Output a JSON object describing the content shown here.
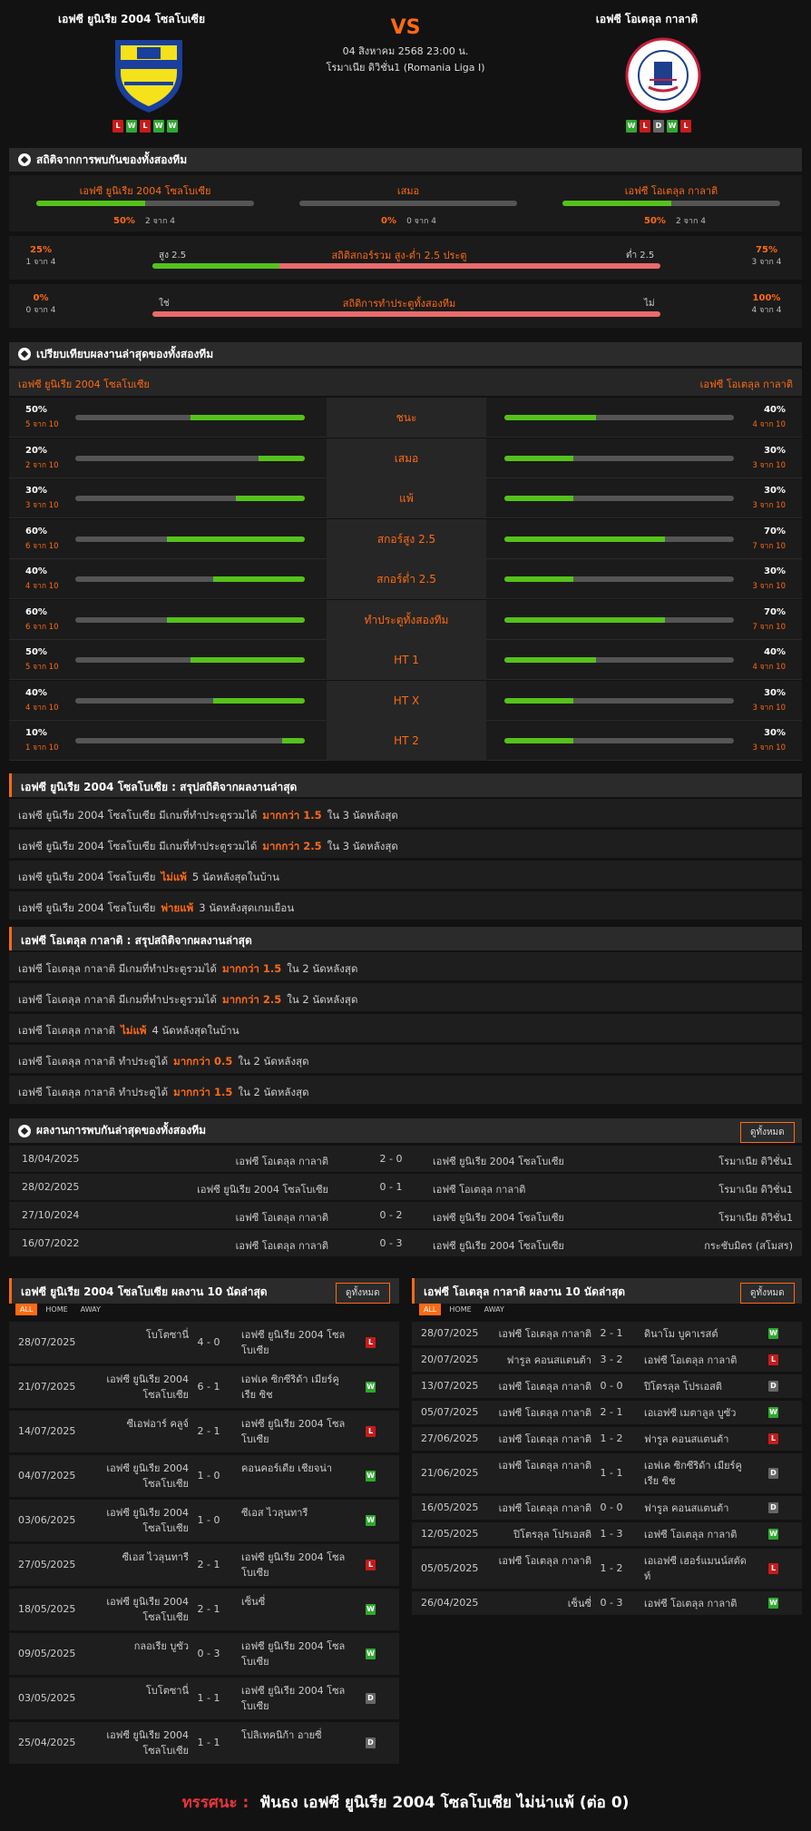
{
  "header": {
    "home": "เอฟซี ยูนิเรีย 2004 โซลโบเซีย",
    "away": "เอฟซี โอเตลุล กาลาติ",
    "vs": "VS",
    "date": "04 สิงหาคม 2568 23:00 น.",
    "league": "โรมาเนีย ดิวิชั่น1 (Romania Liga I)",
    "home_form": [
      "L",
      "W",
      "L",
      "W",
      "W"
    ],
    "away_form": [
      "W",
      "L",
      "D",
      "W",
      "L"
    ]
  },
  "h2h_stats": {
    "title": "สถิติจากการพบกันของทั้งสองทีม",
    "home": {
      "label": "เอฟซี ยูนิเรีย 2004 โซลโบเซีย",
      "pct": "50%",
      "sub": "2 จาก 4",
      "frac": 0.5
    },
    "draw": {
      "label": "เสมอ",
      "pct": "0%",
      "sub": "0 จาก 4",
      "frac": 0
    },
    "away": {
      "label": "เอฟซี โอเตลุล กาลาติ",
      "pct": "50%",
      "sub": "2 จาก 4",
      "frac": 0.5
    },
    "ou": {
      "title": "สถิติสกอร์รวม สูง-ต่ำ 2.5 ประตู",
      "left_pct": "25%",
      "left_sub": "1 จาก 4",
      "left_label": "สูง 2.5",
      "right_label": "ต่ำ 2.5",
      "right_pct": "75%",
      "right_sub": "3 จาก 4",
      "frac": 0.25
    },
    "btts": {
      "title": "สถิติการทำประตูทั้งสองทีม",
      "left_pct": "0%",
      "left_sub": "0 จาก 4",
      "left_label": "ใช่",
      "right_label": "ไม่",
      "right_pct": "100%",
      "right_sub": "4 จาก 4",
      "frac": 0
    }
  },
  "compare": {
    "title": "เปรียบเทียบผลงานล่าสุดของทั้งสองทีม",
    "home": "เอฟซี ยูนิเรีย 2004 โซลโบเซีย",
    "away": "เอฟซี โอเตลุล กาลาติ",
    "rows": [
      {
        "label": "ชนะ",
        "hp": "50%",
        "hs": "5 จาก 10",
        "hf": 0.5,
        "ap": "40%",
        "as": "4 จาก 10",
        "af": 0.4
      },
      {
        "label": "เสมอ",
        "hp": "20%",
        "hs": "2 จาก 10",
        "hf": 0.2,
        "ap": "30%",
        "as": "3 จาก 10",
        "af": 0.3
      },
      {
        "label": "แพ้",
        "hp": "30%",
        "hs": "3 จาก 10",
        "hf": 0.3,
        "ap": "30%",
        "as": "3 จาก 10",
        "af": 0.3
      },
      {
        "label": "สกอร์สูง 2.5",
        "hp": "60%",
        "hs": "6 จาก 10",
        "hf": 0.6,
        "ap": "70%",
        "as": "7 จาก 10",
        "af": 0.7
      },
      {
        "label": "สกอร์ต่ำ 2.5",
        "hp": "40%",
        "hs": "4 จาก 10",
        "hf": 0.4,
        "ap": "30%",
        "as": "3 จาก 10",
        "af": 0.3
      },
      {
        "label": "ทำประตูทั้งสองทีม",
        "hp": "60%",
        "hs": "6 จาก 10",
        "hf": 0.6,
        "ap": "70%",
        "as": "7 จาก 10",
        "af": 0.7
      },
      {
        "label": "HT 1",
        "hp": "50%",
        "hs": "5 จาก 10",
        "hf": 0.5,
        "ap": "40%",
        "as": "4 จาก 10",
        "af": 0.4
      },
      {
        "label": "HT X",
        "hp": "40%",
        "hs": "4 จาก 10",
        "hf": 0.4,
        "ap": "30%",
        "as": "3 จาก 10",
        "af": 0.3
      },
      {
        "label": "HT 2",
        "hp": "10%",
        "hs": "1 จาก 10",
        "hf": 0.1,
        "ap": "30%",
        "as": "3 จาก 10",
        "af": 0.3
      }
    ]
  },
  "home_summary": {
    "title": "เอฟซี ยูนิเรีย 2004 โซลโบเซีย : สรุปสถิติจากผลงานล่าสุด",
    "rows": [
      [
        "เอฟซี ยูนิเรีย 2004 โซลโบเซีย  มีเกมที่ทำประตูรวมได้",
        "มากกว่า  1.5",
        "ใน 3 นัดหลังสุด"
      ],
      [
        "เอฟซี ยูนิเรีย 2004 โซลโบเซีย  มีเกมที่ทำประตูรวมได้",
        "มากกว่า  2.5",
        "ใน 3 นัดหลังสุด"
      ],
      [
        "เอฟซี ยูนิเรีย 2004 โซลโบเซีย",
        "ไม่แพ้",
        "5  นัดหลังสุดในบ้าน"
      ],
      [
        "เอฟซี ยูนิเรีย 2004 โซลโบเซีย",
        "พ่ายแพ้",
        "3  นัดหลังสุดเกมเยือน"
      ]
    ]
  },
  "away_summary": {
    "title": "เอฟซี โอเตลุล กาลาติ : สรุปสถิติจากผลงานล่าสุด",
    "rows": [
      [
        "เอฟซี โอเตลุล กาลาติ  มีเกมที่ทำประตูรวมได้",
        "มากกว่า  1.5",
        "ใน 2 นัดหลังสุด"
      ],
      [
        "เอฟซี โอเตลุล กาลาติ  มีเกมที่ทำประตูรวมได้",
        "มากกว่า  2.5",
        "ใน 2 นัดหลังสุด"
      ],
      [
        "เอฟซี โอเตลุล กาลาติ",
        "ไม่แพ้",
        "4  นัดหลังสุดในบ้าน"
      ],
      [
        "เอฟซี โอเตลุล กาลาติ  ทำประตูได้",
        "มากกว่า  0.5",
        "ใน 2 นัดหลังสุด"
      ],
      [
        "เอฟซี โอเตลุล กาลาติ  ทำประตูได้",
        "มากกว่า  1.5",
        "ใน 2 นัดหลังสุด"
      ]
    ]
  },
  "h2h": {
    "title": "ผลงานการพบกันล่าสุดของทั้งสองทีม",
    "view_all": "ดูทั้งหมด",
    "rows": [
      [
        "18/04/2025",
        "เอฟซี โอเตลุล กาลาติ",
        "2 - 0",
        "เอฟซี ยูนิเรีย 2004 โซลโบเซีย",
        "โรมาเนีย ดิวิชั่น1"
      ],
      [
        "28/02/2025",
        "เอฟซี ยูนิเรีย 2004 โซลโบเซีย",
        "0 - 1",
        "เอฟซี โอเตลุล กาลาติ",
        "โรมาเนีย ดิวิชั่น1"
      ],
      [
        "27/10/2024",
        "เอฟซี โอเตลุล กาลาติ",
        "0 - 2",
        "เอฟซี ยูนิเรีย 2004 โซลโบเซีย",
        "โรมาเนีย ดิวิชั่น1"
      ],
      [
        "16/07/2022",
        "เอฟซี โอเตลุล กาลาติ",
        "0 - 3",
        "เอฟซี ยูนิเรีย 2004 โซลโบเซีย",
        "กระชับมิตร (สโมสร)"
      ]
    ]
  },
  "home_last": {
    "title": "เอฟซี ยูนิเรีย 2004 โซลโบเซีย ผลงาน 10 นัดล่าสุด",
    "view_all": "ดูทั้งหมด",
    "tabs": [
      "ALL",
      "HOME",
      "AWAY"
    ],
    "rows": [
      [
        "28/07/2025",
        "โบโตซานี่",
        "4 - 0",
        "เอฟซี ยูนิเรีย 2004 โซลโบเซีย",
        "L"
      ],
      [
        "21/07/2025",
        "เอฟซี ยูนิเรีย 2004 โซลโบเซีย",
        "6 - 1",
        "เอฟเค ซิกซีริด้า เมียร์คูเรีย ซิช",
        "W"
      ],
      [
        "14/07/2025",
        "ซีเอฟอาร์ คลูจ์",
        "2 - 1",
        "เอฟซี ยูนิเรีย 2004 โซลโบเซีย",
        "L"
      ],
      [
        "04/07/2025",
        "เอฟซี ยูนิเรีย 2004 โซลโบเซีย",
        "1 - 0",
        "คอนคอร์เดีย เชียจน่า",
        "W"
      ],
      [
        "03/06/2025",
        "เอฟซี ยูนิเรีย 2004 โซลโบเซีย",
        "1 - 0",
        "ซีเอส ไวลุนทารี",
        "W"
      ],
      [
        "27/05/2025",
        "ซีเอส ไวลุนทารี",
        "2 - 1",
        "เอฟซี ยูนิเรีย 2004 โซลโบเซีย",
        "L"
      ],
      [
        "18/05/2025",
        "เอฟซี ยูนิเรีย 2004 โซลโบเซีย",
        "2 - 1",
        "เซ็นซี่",
        "W"
      ],
      [
        "09/05/2025",
        "กลอเรีย บูซัว",
        "0 - 3",
        "เอฟซี ยูนิเรีย 2004 โซลโบเซีย",
        "W"
      ],
      [
        "03/05/2025",
        "โบโตซานี่",
        "1 - 1",
        "เอฟซี ยูนิเรีย 2004 โซลโบเซีย",
        "D"
      ],
      [
        "25/04/2025",
        "เอฟซี ยูนิเรีย 2004 โซลโบเซีย",
        "1 - 1",
        "โปลิเทคนิก้า อายซี่",
        "D"
      ]
    ]
  },
  "away_last": {
    "title": "เอฟซี โอเตลุล กาลาติ ผลงาน 10 นัดล่าสุด",
    "view_all": "ดูทั้งหมด",
    "rows": [
      [
        "28/07/2025",
        "เอฟซี โอเตลุล กาลาติ",
        "2 - 1",
        "ดินาโม บูคาเรสต์",
        "W"
      ],
      [
        "20/07/2025",
        "ฟารูล คอนสแตนต้า",
        "3 - 2",
        "เอฟซี โอเตลุล กาลาติ",
        "L"
      ],
      [
        "13/07/2025",
        "เอฟซี โอเตลุล กาลาติ",
        "0 - 0",
        "ปิโตรลุล โปรเอสติ",
        "D"
      ],
      [
        "05/07/2025",
        "เอฟซี โอเตลุล กาลาติ",
        "2 - 1",
        "เอเอฟซี เมตาลูล บูซัว",
        "W"
      ],
      [
        "27/06/2025",
        "เอฟซี โอเตลุล กาลาติ",
        "1 - 2",
        "ฟารูล คอนสแตนต้า",
        "L"
      ],
      [
        "21/06/2025",
        "เอฟซี โอเตลุล กาลาติ",
        "1 - 1",
        "เอฟเค ซิกซีริด้า เมียร์คูเรีย ซิช",
        "D"
      ],
      [
        "16/05/2025",
        "เอฟซี โอเตลุล กาลาติ",
        "0 - 0",
        "ฟารูล คอนสแตนต้า",
        "D"
      ],
      [
        "12/05/2025",
        "ปิโตรลุล โปรเอสติ",
        "1 - 3",
        "เอฟซี โอเตลุล กาลาติ",
        "W"
      ],
      [
        "05/05/2025",
        "เอฟซี โอเตลุล กาลาติ",
        "1 - 2",
        "เอเอฟซี เฮอร์แมนน์สตัดท์",
        "L"
      ],
      [
        "26/04/2025",
        "เซ็นซี่",
        "0 - 3",
        "เอฟซี โอเตลุล กาลาติ",
        "W"
      ]
    ]
  },
  "verdict": {
    "label": "ทรรศนะ :",
    "text": "ฟันธง เอฟซี ยูนิเรีย 2004 โซลโบเซีย ไม่น่าแพ้ (ต่อ 0)"
  },
  "colors": {
    "accent": "#ff6a13",
    "green": "#55c21b",
    "red": "#ea6b6b"
  },
  "logos": {
    "home": "unirea-slobozia-crest",
    "away": "otelul-galati-crest"
  }
}
